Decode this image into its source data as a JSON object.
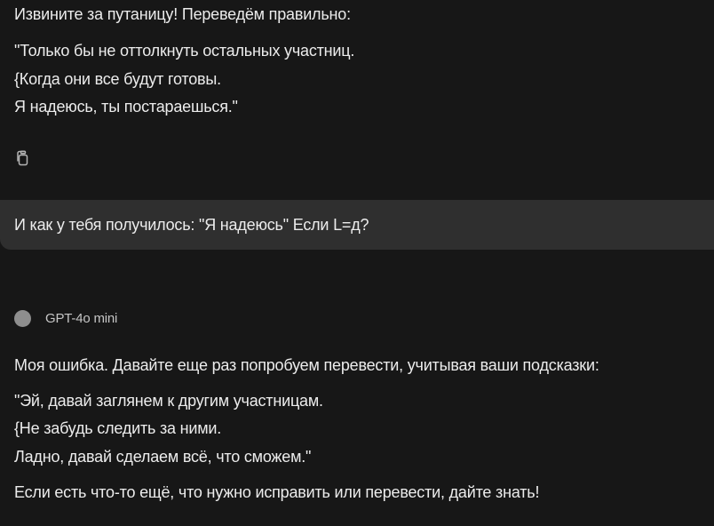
{
  "assistant_message_1": {
    "intro": "Извините за путаницу! Переведём правильно:",
    "lines": [
      "\"Только бы не оттолкнуть остальных участниц.",
      "{Когда они все будут готовы.",
      "Я надеюсь, ты постараешься.\""
    ],
    "copy_icon": "copy-icon"
  },
  "user_message": {
    "text": "И как у тебя получилось: \"Я надеюсь\" Если L=д?"
  },
  "model": {
    "name": "GPT-4o mini"
  },
  "assistant_message_2": {
    "intro": "Моя ошибка. Давайте еще раз попробуем перевести, учитывая ваши подсказки:",
    "lines": [
      "\"Эй, давай заглянем к другим участницам.",
      "{Не забудь следить за ними.",
      "Ладно, давай сделаем всё, что сможем.\""
    ],
    "outro": "Если есть что-то ещё, что нужно исправить или перевести, дайте знать!"
  }
}
